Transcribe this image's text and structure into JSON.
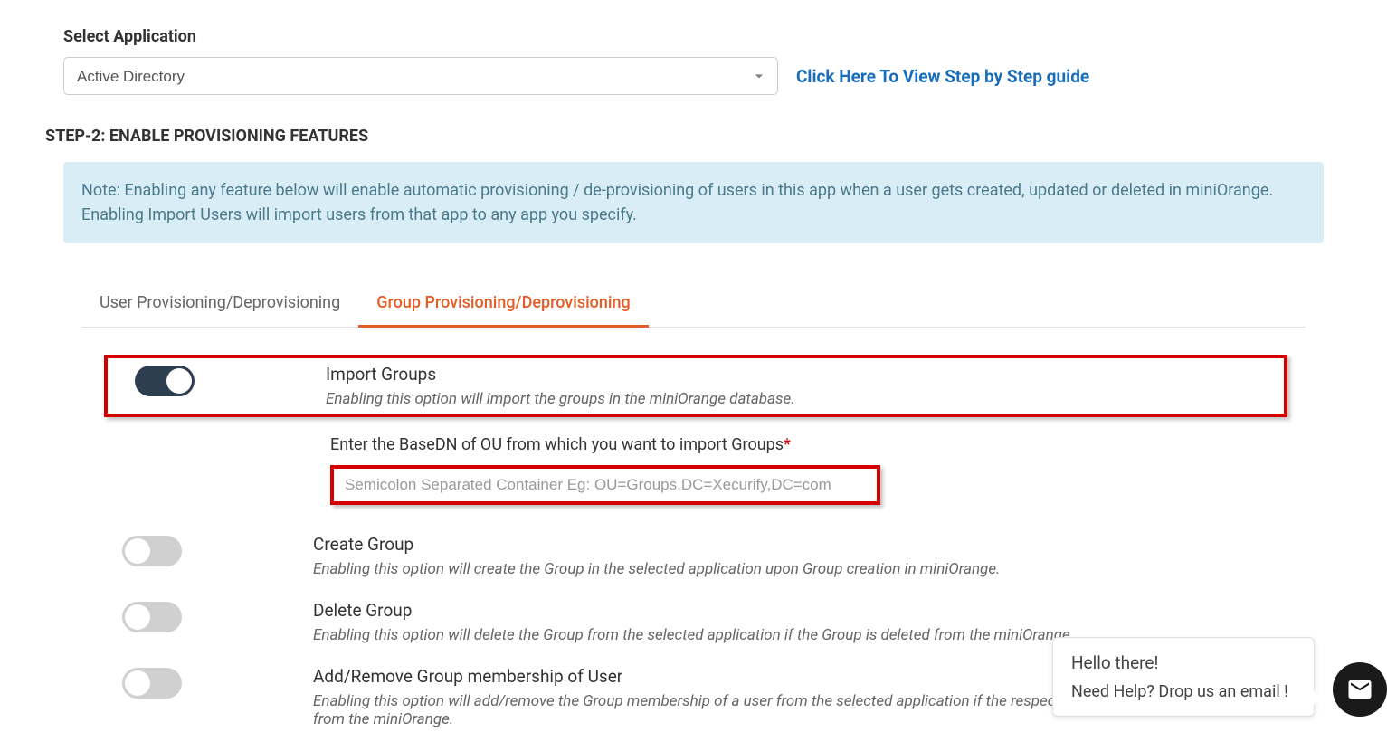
{
  "header": {
    "select_label": "Select Application",
    "selected_app": "Active Directory",
    "guide_link": "Click Here To View Step by Step guide"
  },
  "step2": {
    "heading": "STEP-2: ENABLE PROVISIONING FEATURES",
    "note": "Note: Enabling any feature below will enable automatic provisioning / de-provisioning of users in this app when a user gets created, updated or deleted in miniOrange. Enabling Import Users will import users from that app to any app you specify."
  },
  "tabs": {
    "user": "User Provisioning/Deprovisioning",
    "group": "Group Provisioning/Deprovisioning"
  },
  "options": {
    "import_groups": {
      "title": "Import Groups",
      "desc": "Enabling this option will import the groups in the miniOrange database."
    },
    "basedn": {
      "label": "Enter the BaseDN of OU from which you want to import Groups",
      "placeholder": "Semicolon Separated Container Eg: OU=Groups,DC=Xecurify,DC=com"
    },
    "create_group": {
      "title": "Create Group",
      "desc": "Enabling this option will create the Group in the selected application upon Group creation in miniOrange."
    },
    "delete_group": {
      "title": "Delete Group",
      "desc": "Enabling this option will delete the Group from the selected application if the Group is deleted from the miniOrange."
    },
    "add_remove": {
      "title": "Add/Remove Group membership of User",
      "desc": "Enabling this option will add/remove the Group membership of a user from the selected application if the respective user's group has been updated from the miniOrange."
    }
  },
  "chat": {
    "hello": "Hello there!",
    "need": "Need Help? Drop us an email !"
  }
}
